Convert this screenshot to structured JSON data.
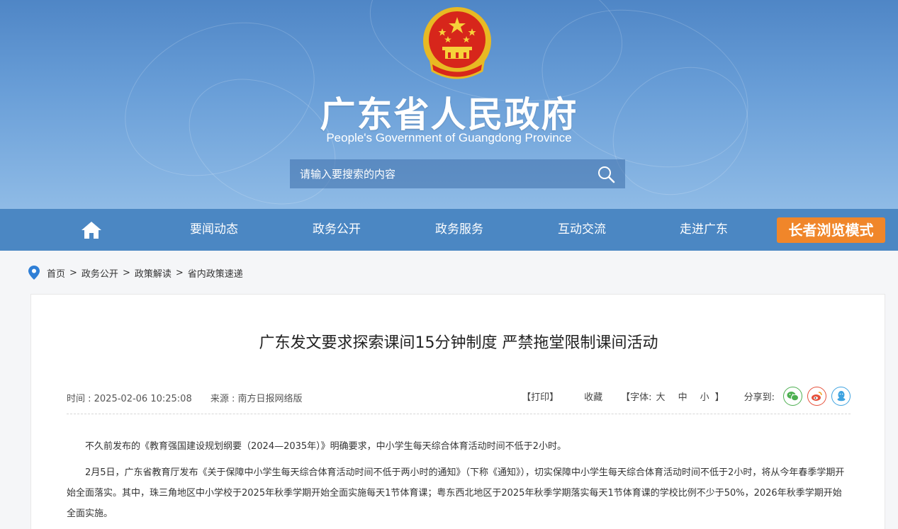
{
  "header": {
    "title": "广东省人民政府",
    "subtitle": "People's Government of Guangdong Province",
    "search_placeholder": "请输入要搜索的内容"
  },
  "nav": {
    "items": [
      "要闻动态",
      "政务公开",
      "政务服务",
      "互动交流",
      "走进广东"
    ],
    "elder_mode": "长者浏览模式"
  },
  "breadcrumb": [
    "首页",
    "政务公开",
    "政策解读",
    "省内政策速递"
  ],
  "breadcrumb_separator": ">",
  "article": {
    "title": "广东发文要求探索课间15分钟制度 严禁拖堂限制课间活动",
    "time": "时间 : 2025-02-06 10:25:08",
    "source": "来源 : 南方日报网络版",
    "print": "【打印】",
    "favorite": "收藏",
    "font_label": "【字体:",
    "font_large": "大",
    "font_medium": "中",
    "font_small": "小",
    "font_close": "】",
    "share_label": "分享到:",
    "share_icons": [
      "wechat-icon",
      "weibo-icon",
      "qq-icon"
    ],
    "paragraphs": [
      "不久前发布的《教育强国建设规划纲要（2024—2035年）》明确要求，中小学生每天综合体育活动时间不低于2小时。",
      "2月5日，广东省教育厅发布《关于保障中小学生每天综合体育活动时间不低于两小时的通知》（下称《通知》），切实保障中小学生每天综合体育活动时间不低于2小时，将从今年春季学期开始全面落实。其中，珠三角地区中小学校于2025年秋季学期开始全面实施每天1节体育课；粤东西北地区于2025年秋季学期落实每天1节体育课的学校比例不少于50%，2026年秋季学期开始全面实施。"
    ]
  },
  "colors": {
    "nav_bg": "#4b87c3",
    "elder_button": "#f0862a",
    "wechat": "#4caf50",
    "weibo": "#e6513b",
    "qq": "#3ea3e0"
  }
}
